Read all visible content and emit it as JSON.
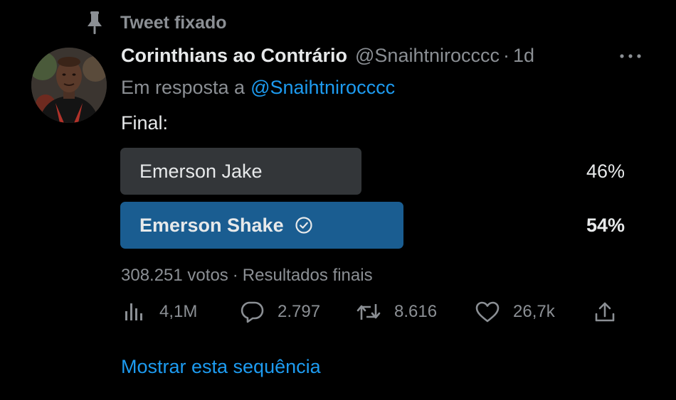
{
  "pinned": {
    "label": "Tweet fixado",
    "icon": "pin-icon"
  },
  "author": {
    "display_name": "Corinthians ao Contrário",
    "handle": "@Snaihtnirocccc",
    "separator": "·",
    "time": "1d",
    "avatar_icon": "avatar-photo"
  },
  "reply": {
    "prefix": "Em resposta a",
    "handle": "@Snaihtnirocccc"
  },
  "tweet": {
    "text": "Final:"
  },
  "poll": {
    "options": [
      {
        "label": "Emerson Jake",
        "percent": "46%",
        "winner": false
      },
      {
        "label": "Emerson Shake",
        "percent": "54%",
        "winner": true
      }
    ],
    "votes": "308.251 votos",
    "separator": "·",
    "status": "Resultados finais"
  },
  "actions": {
    "views": {
      "icon": "views-icon",
      "count": "4,1M"
    },
    "replies": {
      "icon": "reply-icon",
      "count": "2.797"
    },
    "retweets": {
      "icon": "retweet-icon",
      "count": "8.616"
    },
    "likes": {
      "icon": "heart-icon",
      "count": "26,7k"
    },
    "share": {
      "icon": "share-icon"
    }
  },
  "show_thread": "Mostrar esta sequência",
  "colors": {
    "background": "#000000",
    "text": "#e7e9ea",
    "muted": "#8b8f94",
    "link": "#1d9bf0",
    "poll_loser": "#333639",
    "poll_winner": "#1a5d91"
  }
}
